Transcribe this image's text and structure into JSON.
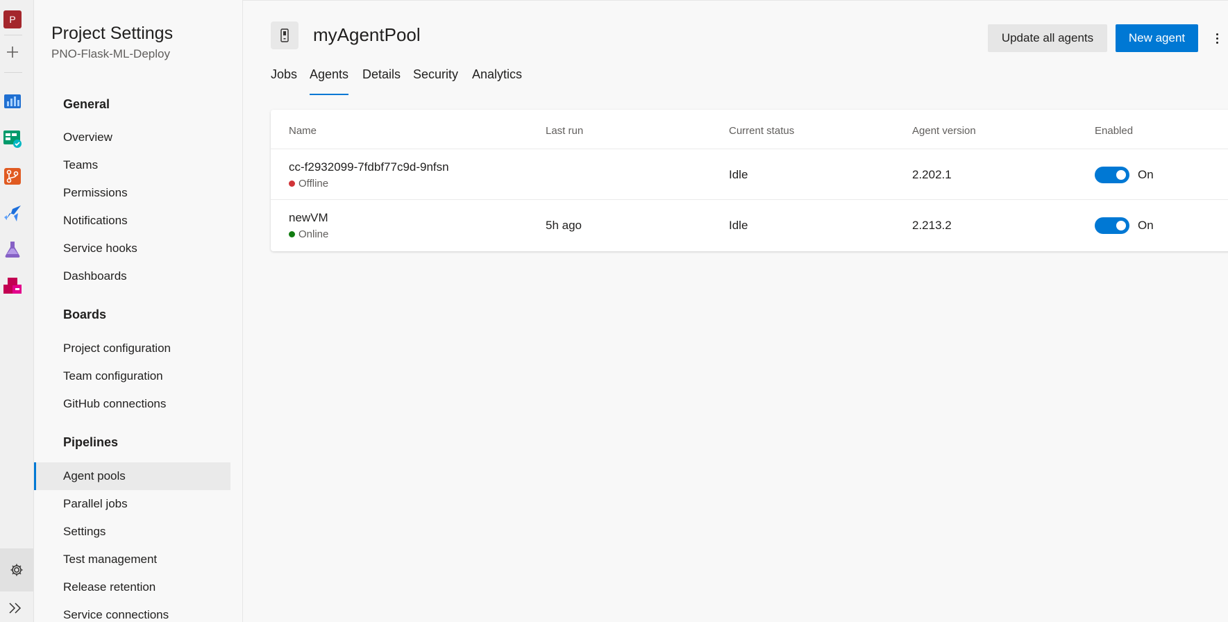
{
  "rail": {
    "org_initial": "P",
    "icons": [
      "plus-icon",
      "overview-icon",
      "boards-icon",
      "repos-icon",
      "pipelines-icon",
      "test-plans-icon",
      "artifacts-icon",
      "settings-gear-icon",
      "expand-icon"
    ]
  },
  "settings_nav": {
    "title": "Project Settings",
    "project": "PNO-Flask-ML-Deploy",
    "sections": [
      {
        "heading": "General",
        "items": [
          "Overview",
          "Teams",
          "Permissions",
          "Notifications",
          "Service hooks",
          "Dashboards"
        ]
      },
      {
        "heading": "Boards",
        "items": [
          "Project configuration",
          "Team configuration",
          "GitHub connections"
        ]
      },
      {
        "heading": "Pipelines",
        "items": [
          "Agent pools",
          "Parallel jobs",
          "Settings",
          "Test management",
          "Release retention",
          "Service connections"
        ]
      }
    ],
    "selected_item": "Agent pools"
  },
  "header": {
    "pool_name": "myAgentPool",
    "update_button": "Update all agents",
    "new_button": "New agent"
  },
  "tabs": [
    "Jobs",
    "Agents",
    "Details",
    "Security",
    "Analytics"
  ],
  "active_tab": "Agents",
  "table": {
    "columns": [
      "Name",
      "Last run",
      "Current status",
      "Agent version",
      "Enabled"
    ],
    "rows": [
      {
        "name": "cc-f2932099-7fdbf77c9d-9nfsn",
        "status": "Offline",
        "status_color": "#d13438",
        "last_run": "",
        "current_status": "Idle",
        "version": "2.202.1",
        "enabled": "On"
      },
      {
        "name": "newVM",
        "status": "Online",
        "status_color": "#107c10",
        "last_run": "5h ago",
        "current_status": "Idle",
        "version": "2.213.2",
        "enabled": "On"
      }
    ]
  },
  "colors": {
    "accent": "#0078d4",
    "offline": "#d13438",
    "online": "#107c10"
  }
}
